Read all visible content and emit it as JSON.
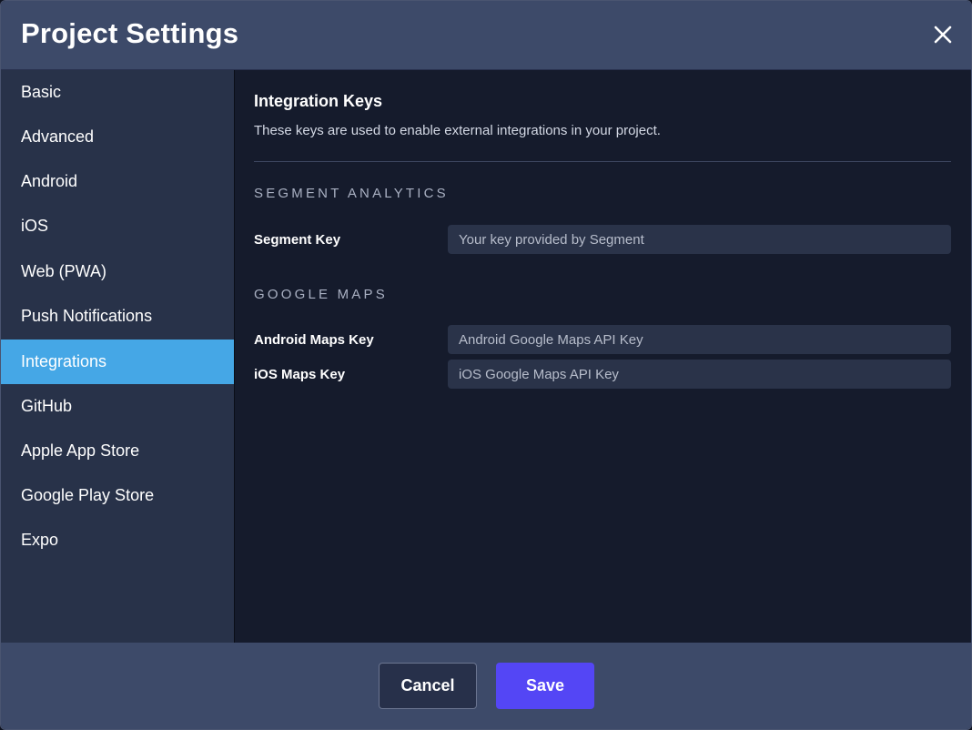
{
  "dialog": {
    "title": "Project Settings",
    "close_icon": "close-icon"
  },
  "sidebar": {
    "active": "Integrations",
    "items": [
      {
        "label": "Basic"
      },
      {
        "label": "Advanced"
      },
      {
        "label": "Android"
      },
      {
        "label": "iOS"
      },
      {
        "label": "Web (PWA)"
      },
      {
        "label": "Push Notifications"
      },
      {
        "label": "Integrations"
      },
      {
        "label": "GitHub"
      },
      {
        "label": "Apple App Store"
      },
      {
        "label": "Google Play Store"
      },
      {
        "label": "Expo"
      }
    ]
  },
  "main": {
    "title": "Integration Keys",
    "description": "These keys are used to enable external integrations in your project.",
    "segment": {
      "heading": "SEGMENT ANALYTICS",
      "key_label": "Segment Key",
      "key_value": "",
      "key_placeholder": "Your key provided by Segment"
    },
    "google_maps": {
      "heading": "GOOGLE MAPS",
      "android_label": "Android Maps Key",
      "android_value": "",
      "android_placeholder": "Android Google Maps API Key",
      "ios_label": "iOS Maps Key",
      "ios_value": "",
      "ios_placeholder": "iOS Google Maps API Key"
    }
  },
  "footer": {
    "cancel_label": "Cancel",
    "save_label": "Save"
  },
  "colors": {
    "header_bg": "#3d4a69",
    "sidebar_bg": "#283249",
    "content_bg": "#151b2c",
    "active_item": "#45a7e6",
    "save_button": "#5446f5"
  }
}
